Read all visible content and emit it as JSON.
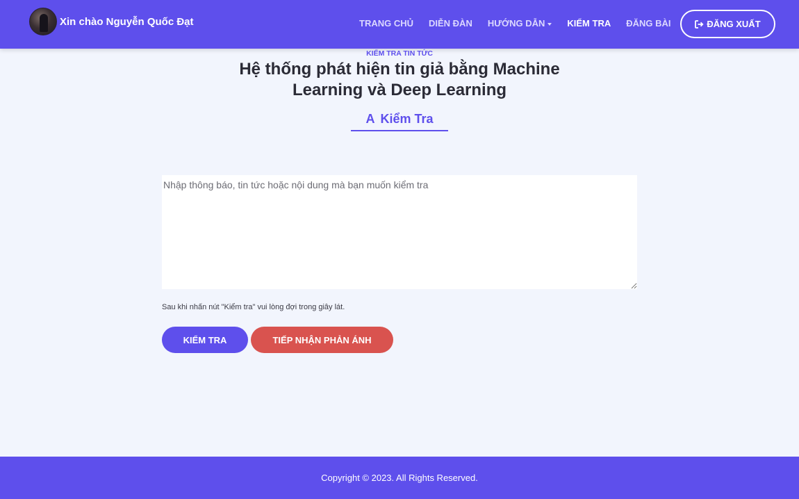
{
  "header": {
    "greeting": "Xin chào Nguyễn Quốc Đạt",
    "nav": [
      {
        "label": "TRANG CHỦ",
        "active": false
      },
      {
        "label": "DIỄN ĐÀN",
        "active": false
      },
      {
        "label": "HƯỚNG DẪN",
        "active": false,
        "dropdown": true
      },
      {
        "label": "KIỂM TRA",
        "active": true
      },
      {
        "label": "ĐĂNG BÀI",
        "active": false
      }
    ],
    "logout_label": "ĐĂNG XUẤT",
    "logout_icon": "sign-out-icon"
  },
  "main": {
    "subtitle": "KIỂM TRA TIN TỨC",
    "title": "Hệ thống phát hiện tin giả bằng Machine Learning và Deep Learning",
    "tab_icon": "A",
    "tab_label": "Kiểm Tra",
    "textarea_placeholder": "Nhập thông báo, tin tức hoặc nội dung mà bạn muốn kiểm tra",
    "hint": "Sau khi nhấn nút \"Kiểm tra\" vui lòng đợi trong giây lát.",
    "check_button": "Kiểm tra",
    "report_button": "Tiếp nhận phản ánh"
  },
  "footer": {
    "copyright": "Copyright © 2023. All Rights Reserved."
  },
  "colors": {
    "primary": "#5e4fec",
    "danger": "#d9534f",
    "background": "#f2f5fd"
  }
}
